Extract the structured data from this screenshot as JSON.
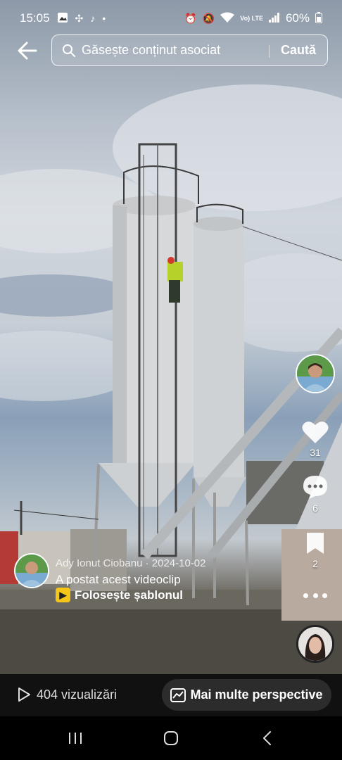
{
  "status_bar": {
    "time": "15:05",
    "network_label": "Vo) LTE",
    "battery": "60%"
  },
  "search": {
    "placeholder": "Găsește conținut asociat",
    "action_label": "Caută"
  },
  "rail": {
    "likes": "31",
    "comments": "6",
    "saves": "2"
  },
  "post": {
    "author": "Ady Ionut Ciobanu",
    "separator": "·",
    "date": "2024-10-02",
    "text": "A postat acest videoclip",
    "template_label": "Folosește șablonul"
  },
  "bottom": {
    "views": "404 vizualizări",
    "insights_label": "Mai multe perspective"
  },
  "icons": [
    "back-arrow-icon",
    "search-icon",
    "heart-icon",
    "comment-icon",
    "bookmark-icon",
    "more-icon",
    "play-icon",
    "chart-icon",
    "recent-apps-icon",
    "home-icon",
    "nav-back-icon"
  ]
}
